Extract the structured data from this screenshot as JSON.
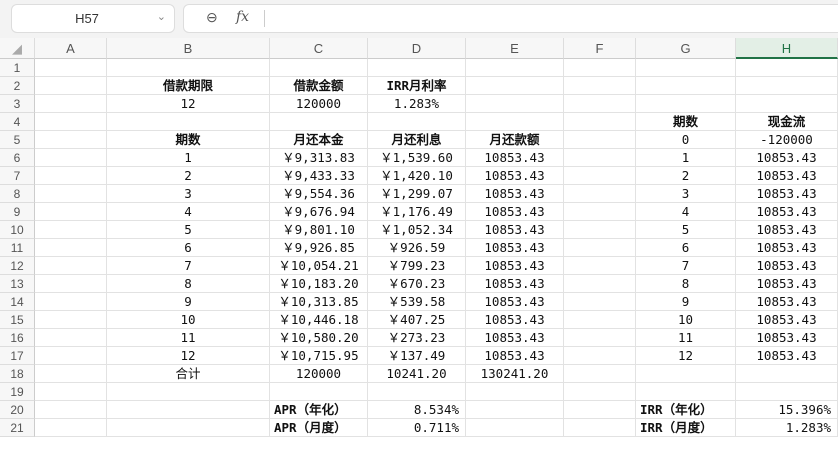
{
  "name_box": "H57",
  "formula": "",
  "columns": [
    "A",
    "B",
    "C",
    "D",
    "E",
    "F",
    "G",
    "H"
  ],
  "selected_column": "H",
  "rows": [
    {
      "n": "1",
      "cells": {}
    },
    {
      "n": "2",
      "cells": {
        "B": "借款期限",
        "C": "借款金额",
        "D": "IRR月利率"
      }
    },
    {
      "n": "3",
      "cells": {
        "B": "12",
        "C": "120000",
        "D": "1.283%"
      }
    },
    {
      "n": "4",
      "cells": {
        "G": "期数",
        "H": "现金流"
      }
    },
    {
      "n": "5",
      "cells": {
        "B": "期数",
        "C": "月还本金",
        "D": "月还利息",
        "E": "月还款额",
        "G": "0",
        "H": "-120000"
      }
    },
    {
      "n": "6",
      "cells": {
        "B": "1",
        "C": "￥9,313.83",
        "D": "￥1,539.60",
        "E": "10853.43",
        "G": "1",
        "H": "10853.43"
      }
    },
    {
      "n": "7",
      "cells": {
        "B": "2",
        "C": "￥9,433.33",
        "D": "￥1,420.10",
        "E": "10853.43",
        "G": "2",
        "H": "10853.43"
      }
    },
    {
      "n": "8",
      "cells": {
        "B": "3",
        "C": "￥9,554.36",
        "D": "￥1,299.07",
        "E": "10853.43",
        "G": "3",
        "H": "10853.43"
      }
    },
    {
      "n": "9",
      "cells": {
        "B": "4",
        "C": "￥9,676.94",
        "D": "￥1,176.49",
        "E": "10853.43",
        "G": "4",
        "H": "10853.43"
      }
    },
    {
      "n": "10",
      "cells": {
        "B": "5",
        "C": "￥9,801.10",
        "D": "￥1,052.34",
        "E": "10853.43",
        "G": "5",
        "H": "10853.43"
      }
    },
    {
      "n": "11",
      "cells": {
        "B": "6",
        "C": "￥9,926.85",
        "D": "￥926.59",
        "E": "10853.43",
        "G": "6",
        "H": "10853.43"
      }
    },
    {
      "n": "12",
      "cells": {
        "B": "7",
        "C": "￥10,054.21",
        "D": "￥799.23",
        "E": "10853.43",
        "G": "7",
        "H": "10853.43"
      }
    },
    {
      "n": "13",
      "cells": {
        "B": "8",
        "C": "￥10,183.20",
        "D": "￥670.23",
        "E": "10853.43",
        "G": "8",
        "H": "10853.43"
      }
    },
    {
      "n": "14",
      "cells": {
        "B": "9",
        "C": "￥10,313.85",
        "D": "￥539.58",
        "E": "10853.43",
        "G": "9",
        "H": "10853.43"
      }
    },
    {
      "n": "15",
      "cells": {
        "B": "10",
        "C": "￥10,446.18",
        "D": "￥407.25",
        "E": "10853.43",
        "G": "10",
        "H": "10853.43"
      }
    },
    {
      "n": "16",
      "cells": {
        "B": "11",
        "C": "￥10,580.20",
        "D": "￥273.23",
        "E": "10853.43",
        "G": "11",
        "H": "10853.43"
      }
    },
    {
      "n": "17",
      "cells": {
        "B": "12",
        "C": "￥10,715.95",
        "D": "￥137.49",
        "E": "10853.43",
        "G": "12",
        "H": "10853.43"
      }
    },
    {
      "n": "18",
      "cells": {
        "B": "合计",
        "C": "120000",
        "D": "10241.20",
        "E": "130241.20"
      }
    },
    {
      "n": "19",
      "cells": {}
    },
    {
      "n": "20",
      "cells": {
        "C": "APR（年化）",
        "D": "8.534%",
        "G": "IRR（年化）",
        "H": "15.396%"
      }
    },
    {
      "n": "21",
      "cells": {
        "C": "APR（月度）",
        "D": "0.711%",
        "G": "IRR（月度）",
        "H": "1.283%"
      }
    }
  ]
}
